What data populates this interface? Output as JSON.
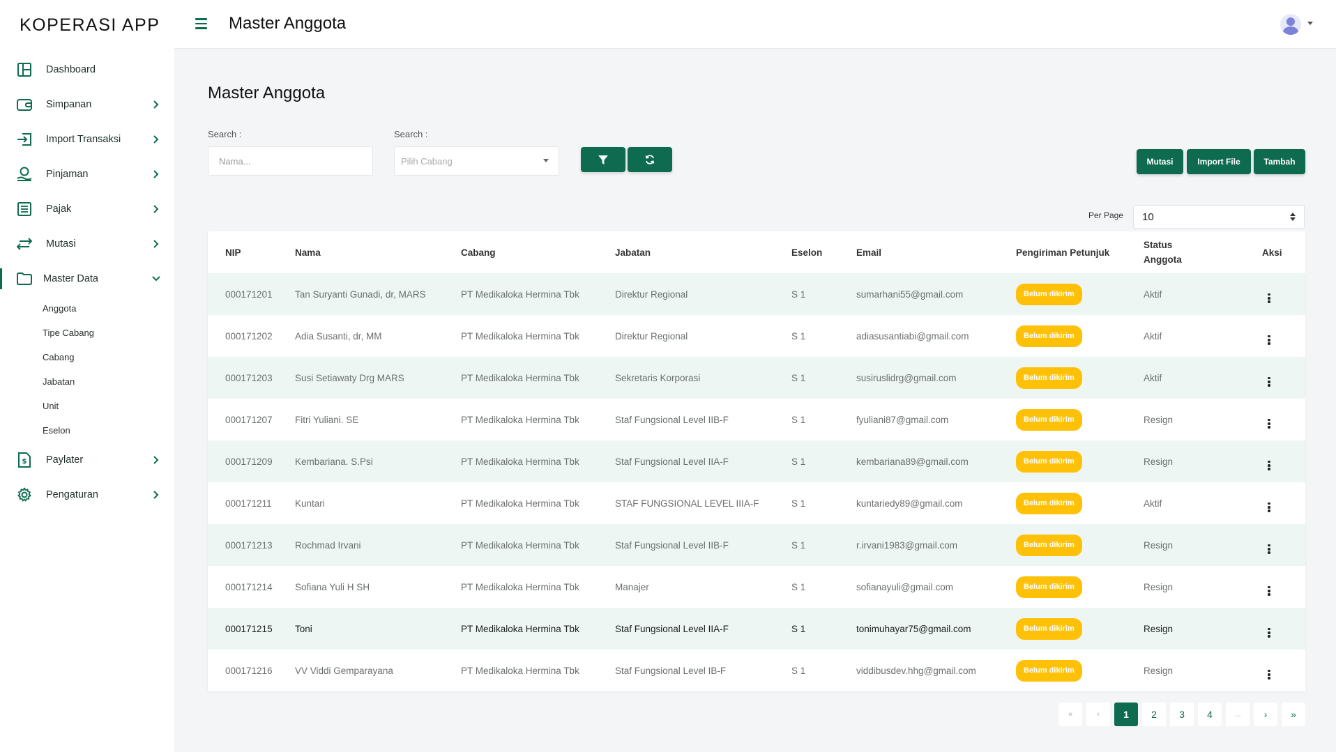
{
  "app": {
    "title": "KOPERASI APP"
  },
  "header": {
    "title": "Master Anggota"
  },
  "sidebar": {
    "items": [
      {
        "label": "Dashboard",
        "icon": "dashboard-icon"
      },
      {
        "label": "Simpanan",
        "icon": "wallet-icon"
      },
      {
        "label": "Import Transaksi",
        "icon": "import-icon"
      },
      {
        "label": "Pinjaman",
        "icon": "loan-icon"
      },
      {
        "label": "Pajak",
        "icon": "list-icon"
      },
      {
        "label": "Mutasi",
        "icon": "transfer-icon"
      },
      {
        "label": "Master Data",
        "icon": "folder-icon"
      },
      {
        "label": "Paylater",
        "icon": "invoice-icon"
      },
      {
        "label": "Pengaturan",
        "icon": "gear-icon"
      }
    ],
    "master_sub": [
      "Anggota",
      "Tipe Cabang",
      "Cabang",
      "Jabatan",
      "Unit",
      "Eselon"
    ]
  },
  "main": {
    "title": "Master Anggota",
    "search1_label": "Search :",
    "search1_placeholder": "Nama...",
    "search2_label": "Search :",
    "search2_placeholder": "Pilih Cabang",
    "buttons": {
      "mutasi": "Mutasi",
      "import": "Import File",
      "tambah": "Tambah"
    },
    "per_page_label": "Per Page",
    "per_page_value": "10"
  },
  "table": {
    "headers": [
      "NIP",
      "Nama",
      "Cabang",
      "Jabatan",
      "Eselon",
      "Email",
      "Pengiriman Petunjuk",
      "Status Anggota",
      "Aksi"
    ],
    "rows": [
      [
        "000171201",
        "Tan Suryanti Gunadi, dr, MARS",
        "PT Medikaloka Hermina Tbk",
        "Direktur Regional",
        "S 1",
        "sumarhani55@gmail.com",
        "Belum dikirim",
        "Aktif"
      ],
      [
        "000171202",
        "Adia Susanti, dr, MM",
        "PT Medikaloka Hermina Tbk",
        "Direktur Regional",
        "S 1",
        "adiasusantiabi@gmail.com",
        "Belum dikirim",
        "Aktif"
      ],
      [
        "000171203",
        "Susi Setiawaty Drg MARS",
        "PT Medikaloka Hermina Tbk",
        "Sekretaris Korporasi",
        "S 1",
        "susiruslidrg@gmail.com",
        "Belum dikirim",
        "Aktif"
      ],
      [
        "000171207",
        "Fitri Yuliani. SE",
        "PT Medikaloka Hermina Tbk",
        "Staf Fungsional Level IIB-F",
        "S 1",
        "fyuliani87@gmail.com",
        "Belum dikirim",
        "Resign"
      ],
      [
        "000171209",
        "Kembariana. S.Psi",
        "PT Medikaloka Hermina Tbk",
        "Staf Fungsional Level IIA-F",
        "S 1",
        "kembariana89@gmail.com",
        "Belum dikirim",
        "Resign"
      ],
      [
        "000171211",
        "Kuntari",
        "PT Medikaloka Hermina Tbk",
        "STAF FUNGSIONAL LEVEL IIIA-F",
        "S 1",
        "kuntariedy89@gmail.com",
        "Belum dikirim",
        "Aktif"
      ],
      [
        "000171213",
        "Rochmad Irvani",
        "PT Medikaloka Hermina Tbk",
        "Staf Fungsional Level IIB-F",
        "S 1",
        "r.irvani1983@gmail.com",
        "Belum dikirim",
        "Resign"
      ],
      [
        "000171214",
        "Sofiana Yuli H SH",
        "PT Medikaloka Hermina Tbk",
        "Manajer",
        "S 1",
        "sofianayuli@gmail.com",
        "Belum dikirim",
        "Resign"
      ],
      [
        "000171215",
        "Toni",
        "PT Medikaloka Hermina Tbk",
        "Staf Fungsional Level IIA-F",
        "S 1",
        "tonimuhayar75@gmail.com",
        "Belum dikirim",
        "Resign"
      ],
      [
        "000171216",
        "VV Viddi Gemparayana",
        "PT Medikaloka Hermina Tbk",
        "Staf Fungsional Level IB-F",
        "S 1",
        "viddibusdev.hhg@gmail.com",
        "Belum dikirim",
        "Resign"
      ]
    ]
  },
  "pagination": {
    "first": "«",
    "prev": "‹",
    "pages": [
      "1",
      "2",
      "3",
      "4"
    ],
    "ellipsis": "...",
    "next": "›",
    "last": "»",
    "current": "1"
  },
  "colors": {
    "primary": "#0e6b4f",
    "badge": "#ffc107",
    "row_stripe": "#eef6f3"
  }
}
